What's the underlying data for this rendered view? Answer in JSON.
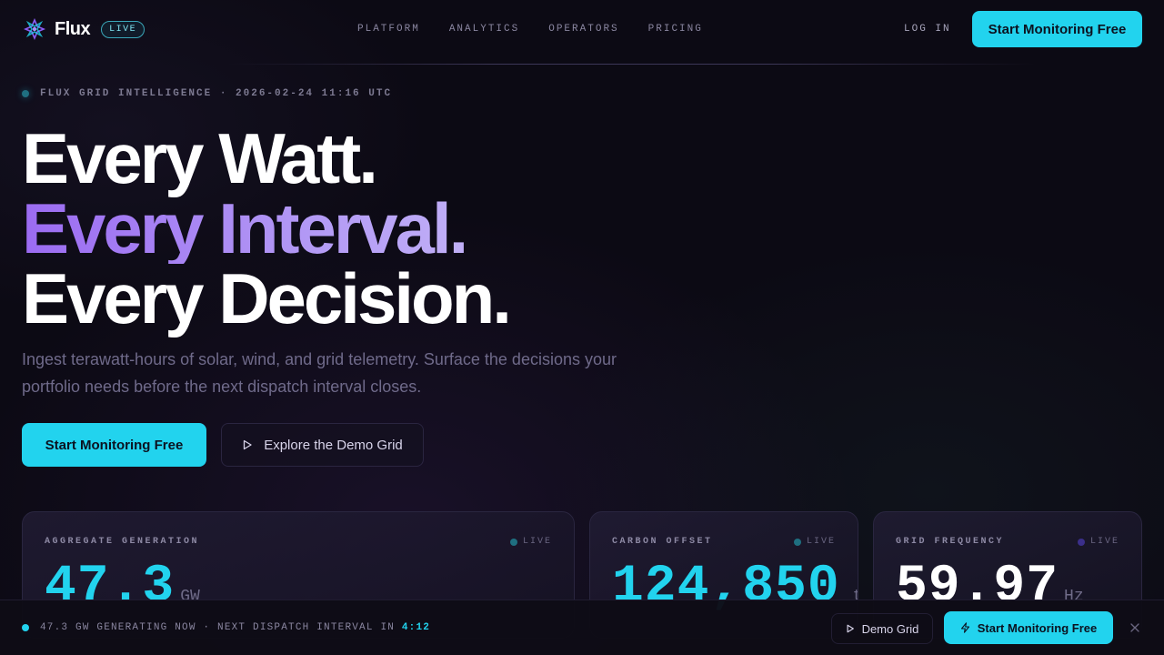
{
  "nav": {
    "brand": "Flux",
    "live_badge": "LIVE",
    "links": [
      "PLATFORM",
      "ANALYTICS",
      "OPERATORS",
      "PRICING"
    ],
    "login": "LOG IN",
    "cta": "Start Monitoring Free"
  },
  "hero": {
    "eyebrow": "FLUX GRID INTELLIGENCE · 2026-02-24 11:16 UTC",
    "line1": "Every Watt.",
    "line2": "Every Interval.",
    "line3": "Every Decision.",
    "subtitle": "Ingest terawatt-hours of solar, wind, and grid telemetry. Surface the decisions your portfolio needs before the next dispatch interval closes.",
    "cta_primary": "Start Monitoring Free",
    "cta_secondary": "Explore the Demo Grid"
  },
  "cards": [
    {
      "label": "AGGREGATE GENERATION",
      "live": "LIVE",
      "value": "47.3",
      "unit": "GW",
      "value_color": "#22d3ee",
      "dot_color": "#1f6f80"
    },
    {
      "label": "CARBON OFFSET",
      "live": "LIVE",
      "value": "124,850",
      "unit": "t",
      "value_color": "#22d3ee",
      "dot_color": "#1f6f80"
    },
    {
      "label": "GRID FREQUENCY",
      "live": "LIVE",
      "value": "59.97",
      "unit": "Hz",
      "value_color": "#ffffff",
      "dot_color": "#3b2f8a"
    }
  ],
  "bottom_bar": {
    "status": "47.3 GW GENERATING NOW · NEXT DISPATCH INTERVAL IN",
    "countdown": "4:12",
    "demo": "Demo Grid",
    "cta": "Start Monitoring Free"
  },
  "colors": {
    "accent": "#22d3ee",
    "purple": "#9b6bf2",
    "background": "#0c0a14"
  }
}
